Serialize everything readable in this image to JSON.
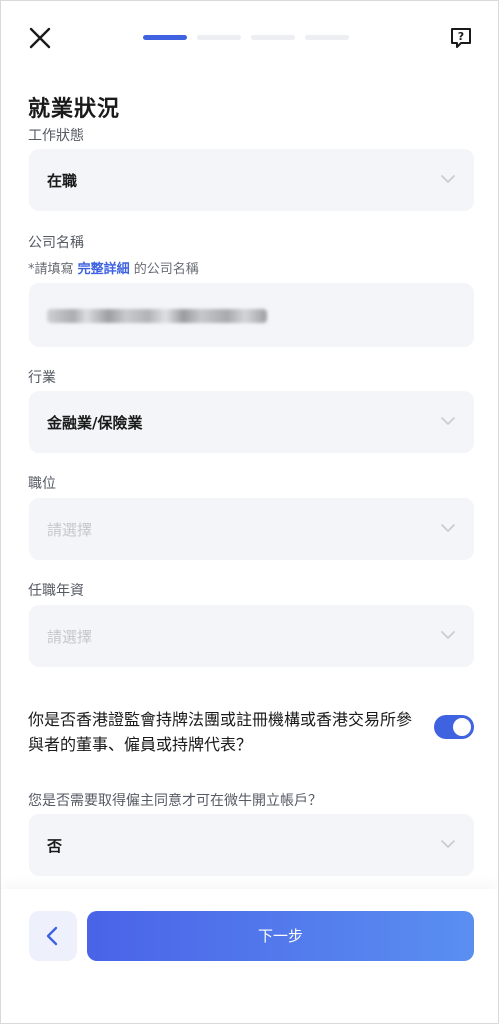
{
  "progress": {
    "total_steps": 4,
    "current_step": 1
  },
  "icons": {
    "close": "close-icon",
    "help": "help-question-icon",
    "chevron": "chevron-down-icon",
    "back": "chevron-left-icon"
  },
  "page": {
    "title": "就業狀況"
  },
  "employment_status": {
    "label": "工作狀態",
    "value": "在職"
  },
  "company": {
    "label": "公司名稱",
    "hint_prefix": "*請填寫 ",
    "hint_emphasis": "完整詳細",
    "hint_suffix": " 的公司名稱",
    "value_redacted": true
  },
  "industry": {
    "label": "行業",
    "value": "金融業/保險業"
  },
  "position": {
    "label": "職位",
    "placeholder": "請選擇"
  },
  "tenure": {
    "label": "任職年資",
    "placeholder": "請選擇"
  },
  "licensed_question": {
    "text": "你是否香港證監會持牌法團或註冊機構或香港交易所參與者的董事、僱員或持牌代表？",
    "toggle_on": true
  },
  "employer_consent": {
    "label": "您是否需要取得僱主同意才可在微牛開立帳戶？",
    "value": "否"
  },
  "footer": {
    "next_label": "下一步"
  },
  "colors": {
    "accent": "#3f63e0",
    "field_bg": "#f4f5f8"
  }
}
